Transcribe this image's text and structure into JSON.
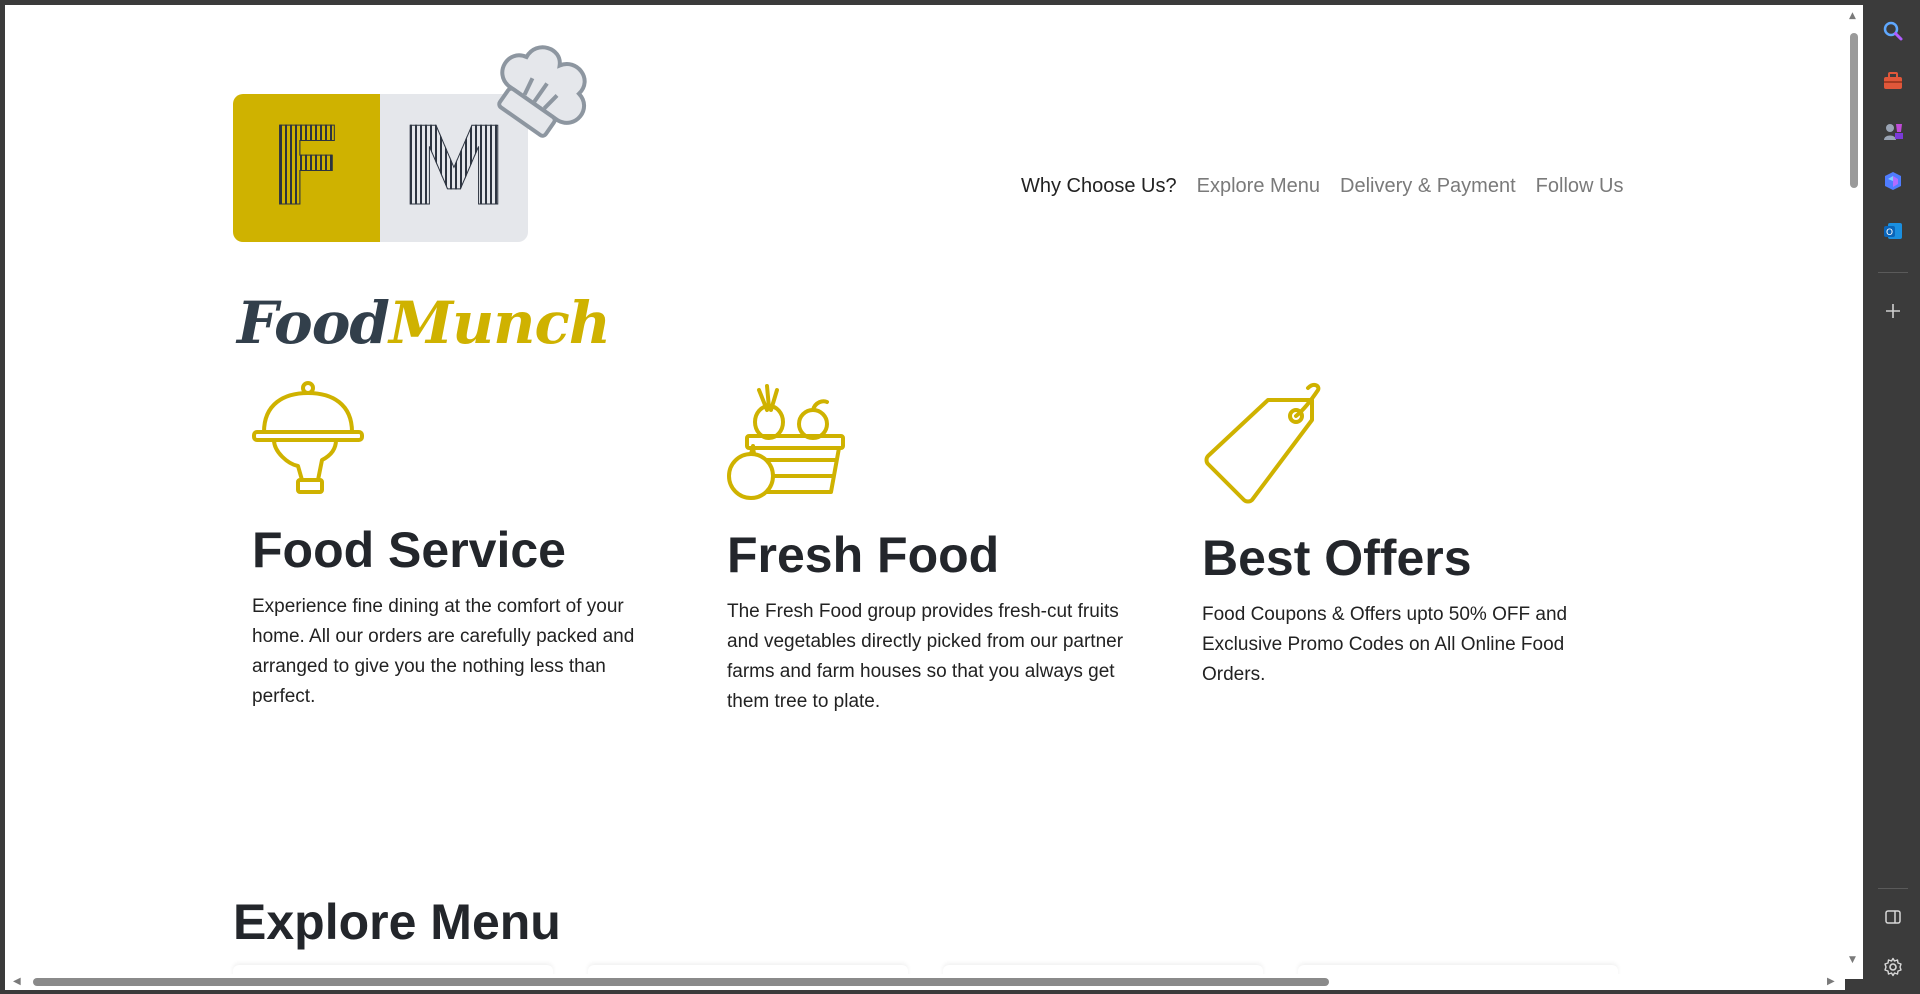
{
  "brand": {
    "logo_left": "F",
    "logo_right": "M",
    "name_part1": "Food",
    "name_part2": "Munch"
  },
  "nav": {
    "items": [
      "Why Choose Us?",
      "Explore Menu",
      "Delivery & Payment",
      "Follow Us"
    ],
    "active": "Why Choose Us?"
  },
  "features": [
    {
      "title": "Food Service",
      "text": "Experience fine dining at the comfort of your home. All our orders are carefully packed and arranged to give you the nothing less than perfect.",
      "icon": "serving-cloche-icon"
    },
    {
      "title": "Fresh Food",
      "text": "The Fresh Food group provides fresh-cut fruits and vegetables directly picked from our partner farms and farm houses so that you always get them tree to plate.",
      "icon": "fruit-basket-icon"
    },
    {
      "title": "Best Offers",
      "text": "Food Coupons & Offers upto 50% OFF and Exclusive Promo Codes on All Online Food Orders.",
      "icon": "price-tag-icon"
    }
  ],
  "sections": {
    "explore_menu_title": "Explore Menu"
  },
  "colors": {
    "accent": "#cfb200",
    "dark": "#323f4b",
    "logo_gray": "#e5e7eb"
  },
  "sidebar_icons": [
    "search-icon",
    "toolbox-icon",
    "games-icon",
    "copilot-icon",
    "outlook-icon",
    "add-icon",
    "split-view-icon",
    "settings-icon"
  ]
}
